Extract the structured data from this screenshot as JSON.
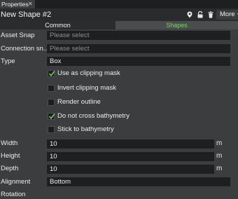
{
  "window": {
    "tab_label": "Properties",
    "tab_close": "✕"
  },
  "header": {
    "title": "New Shape #2",
    "more_label": "More",
    "icons": [
      "location-pin-icon",
      "unlock-icon",
      "trash-icon"
    ]
  },
  "segments": {
    "common": "Common",
    "shapes": "Shapes"
  },
  "fields": {
    "asset_snap": {
      "label": "Asset Snap",
      "value": "Please select"
    },
    "connection_snap": {
      "label": "Connection sn...",
      "value": "Please select"
    },
    "type": {
      "label": "Type",
      "value": "Box"
    }
  },
  "checkboxes": [
    {
      "label": "Use as clipping mask",
      "checked": true
    },
    {
      "label": "Invert clipping mask",
      "checked": false
    },
    {
      "label": "Render outline",
      "checked": false
    },
    {
      "label": "Do not cross bathymetry",
      "checked": true
    },
    {
      "label": "Stick to bathymetry",
      "checked": false
    }
  ],
  "dimensions": {
    "width": {
      "label": "Width",
      "value": "10",
      "unit": "m"
    },
    "height": {
      "label": "Height",
      "value": "10",
      "unit": "m"
    },
    "depth": {
      "label": "Depth",
      "value": "10",
      "unit": "m"
    }
  },
  "alignment": {
    "label": "Alignment",
    "value": "Bottom"
  },
  "rotation": {
    "label": "Rotation"
  },
  "colors": {
    "accent_green": "#7ed36b",
    "check_green": "#6fcf5a"
  }
}
